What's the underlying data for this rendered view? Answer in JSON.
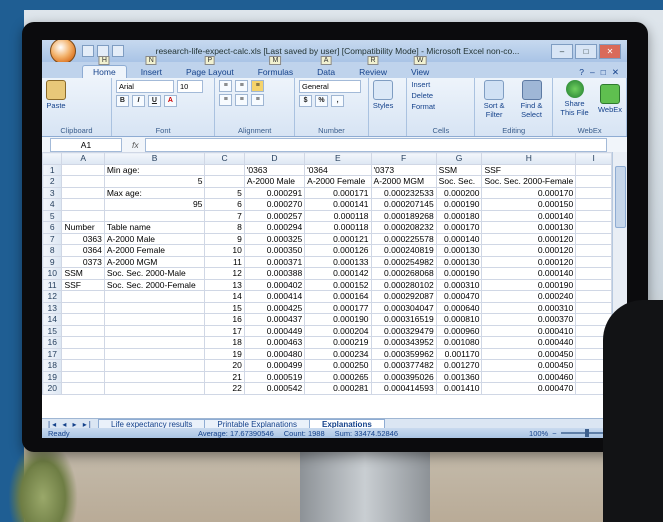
{
  "window": {
    "title": "research-life-expect-calc.xls [Last saved by user] [Compatibility Mode] - Microsoft Excel non-co...",
    "controls": [
      "–",
      "□",
      "✕"
    ]
  },
  "ribbon": {
    "tabs": [
      {
        "label": "Home",
        "key": "H"
      },
      {
        "label": "Insert",
        "key": "N"
      },
      {
        "label": "Page Layout",
        "key": "P"
      },
      {
        "label": "Formulas",
        "key": "M"
      },
      {
        "label": "Data",
        "key": "A"
      },
      {
        "label": "Review",
        "key": "R"
      },
      {
        "label": "View",
        "key": "W"
      }
    ],
    "right_controls": [
      "?",
      "–",
      "□",
      "✕"
    ],
    "font_name": "Arial",
    "font_size": "10",
    "number_format": "General",
    "groups": {
      "clipboard": "Clipboard",
      "font": "Font",
      "alignment": "Alignment",
      "number": "Number",
      "cells": "Cells",
      "editing": "Editing",
      "webex": "WebEx"
    },
    "buttons": {
      "paste": "Paste",
      "styles": "Styles",
      "insert": "Insert",
      "delete": "Delete",
      "format": "Format",
      "sort_filter": "Sort & Filter",
      "find_select": "Find & Select",
      "share_file": "Share This File",
      "webex": "WebEx"
    }
  },
  "formula_bar": {
    "name_box": "A1",
    "fx": "fx",
    "value": ""
  },
  "grid": {
    "columns": [
      "A",
      "B",
      "C",
      "D",
      "E",
      "F",
      "G",
      "H",
      "I"
    ],
    "rows": [
      [
        "1",
        "",
        "Min age:",
        "",
        "'0363",
        "'0364",
        "'0373",
        "SSM",
        "SSF",
        ""
      ],
      [
        "2",
        "",
        "5",
        "",
        "A-2000 Male",
        "A-2000 Female",
        "A-2000 MGM",
        "Soc. Sec.",
        "Soc. Sec. 2000-Female",
        ""
      ],
      [
        "3",
        "",
        "Max age:",
        "5",
        "0.000291",
        "0.000171",
        "0.000232533",
        "0.000200",
        "0.000170",
        ""
      ],
      [
        "4",
        "",
        "95",
        "6",
        "0.000270",
        "0.000141",
        "0.000207145",
        "0.000190",
        "0.000150",
        ""
      ],
      [
        "5",
        "",
        "",
        "7",
        "0.000257",
        "0.000118",
        "0.000189268",
        "0.000180",
        "0.000140",
        ""
      ],
      [
        "6",
        "Number",
        "Table name",
        "8",
        "0.000294",
        "0.000118",
        "0.000208232",
        "0.000170",
        "0.000130",
        ""
      ],
      [
        "7",
        "0363",
        "A-2000 Male",
        "9",
        "0.000325",
        "0.000121",
        "0.000225578",
        "0.000140",
        "0.000120",
        ""
      ],
      [
        "8",
        "0364",
        "A-2000 Female",
        "10",
        "0.000350",
        "0.000126",
        "0.000240819",
        "0.000130",
        "0.000120",
        ""
      ],
      [
        "9",
        "0373",
        "A-2000 MGM",
        "11",
        "0.000371",
        "0.000133",
        "0.000254982",
        "0.000130",
        "0.000120",
        ""
      ],
      [
        "10",
        "SSM",
        "Soc. Sec. 2000-Male",
        "12",
        "0.000388",
        "0.000142",
        "0.000268068",
        "0.000190",
        "0.000140",
        ""
      ],
      [
        "11",
        "SSF",
        "Soc. Sec. 2000-Female",
        "13",
        "0.000402",
        "0.000152",
        "0.000280102",
        "0.000310",
        "0.000190",
        ""
      ],
      [
        "12",
        "",
        "",
        "14",
        "0.000414",
        "0.000164",
        "0.000292087",
        "0.000470",
        "0.000240",
        ""
      ],
      [
        "13",
        "",
        "",
        "15",
        "0.000425",
        "0.000177",
        "0.000304047",
        "0.000640",
        "0.000310",
        ""
      ],
      [
        "14",
        "",
        "",
        "16",
        "0.000437",
        "0.000190",
        "0.000316519",
        "0.000810",
        "0.000370",
        ""
      ],
      [
        "15",
        "",
        "",
        "17",
        "0.000449",
        "0.000204",
        "0.000329479",
        "0.000960",
        "0.000410",
        ""
      ],
      [
        "16",
        "",
        "",
        "18",
        "0.000463",
        "0.000219",
        "0.000343952",
        "0.001080",
        "0.000440",
        ""
      ],
      [
        "17",
        "",
        "",
        "19",
        "0.000480",
        "0.000234",
        "0.000359962",
        "0.001170",
        "0.000450",
        ""
      ],
      [
        "18",
        "",
        "",
        "20",
        "0.000499",
        "0.000250",
        "0.000377482",
        "0.001270",
        "0.000450",
        ""
      ],
      [
        "19",
        "",
        "",
        "21",
        "0.000519",
        "0.000265",
        "0.000395026",
        "0.001360",
        "0.000460",
        ""
      ],
      [
        "20",
        "",
        "",
        "22",
        "0.000542",
        "0.000281",
        "0.000414593",
        "0.001410",
        "0.000470",
        ""
      ]
    ]
  },
  "sheet_tabs": {
    "nav": "|◂ ◂ ▸ ▸|",
    "tabs": [
      "Life expectancy results",
      "Printable Explanations",
      "Explanations"
    ],
    "active_index": 2
  },
  "status_bar": {
    "state": "Ready",
    "average": "Average: 17.67390546",
    "count": "Count: 1988",
    "sum": "Sum: 33474.52846",
    "zoom": "100%"
  }
}
